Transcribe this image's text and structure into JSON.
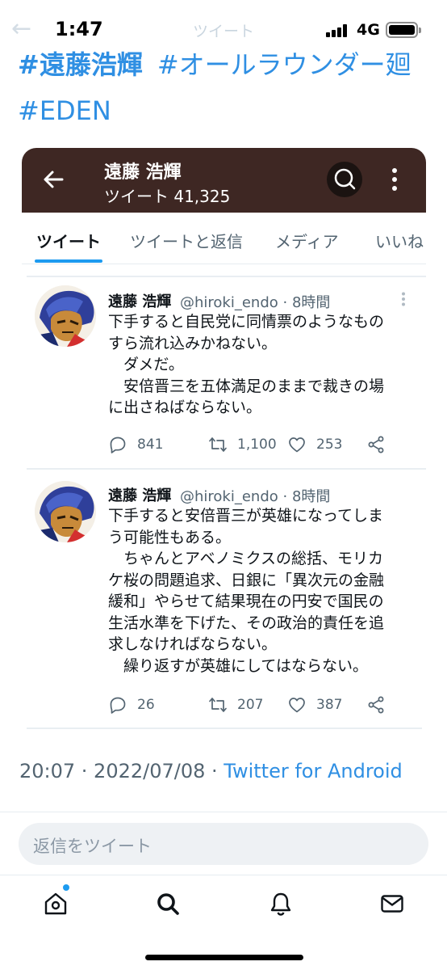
{
  "status_bar": {
    "time": "1:47",
    "network": "4G",
    "behind_title": "ツイート",
    "behind_back": "←"
  },
  "hashtags": [
    {
      "text": "#遠藤浩輝",
      "bold": true
    },
    {
      "text": "#オールラウンダー廻",
      "bold": false
    },
    {
      "text": "#EDEN",
      "bold": false
    }
  ],
  "embedded": {
    "header": {
      "name": "遠藤 浩輝",
      "tweet_count": "ツイート 41,325",
      "background": "#3e2723"
    },
    "tabs": [
      "ツイート",
      "ツイートと返信",
      "メディア",
      "いいね"
    ],
    "active_tab": 0,
    "tweets": [
      {
        "name": "遠藤 浩輝",
        "handle": "@hiroki_endo · 8時間",
        "lines": [
          "下手すると自民党に同情票のようなもの",
          "すら流れ込みかねない。",
          "　ダメだ。",
          "　安倍晋三を五体満足のままで裁きの場",
          "に出さねばならない。"
        ],
        "replies": "841",
        "retweets": "1,100",
        "likes": "253"
      },
      {
        "name": "遠藤 浩輝",
        "handle": "@hiroki_endo · 8時間",
        "lines": [
          "下手すると安倍晋三が英雄になってしま",
          "う可能性もある。",
          "　ちゃんとアベノミクスの総括、モリカ",
          "ケ桜の問題追求、日銀に「異次元の金融",
          "緩和」やらせて結果現在の円安で国民の",
          "生活水準を下げた、その政治的責任を追",
          "求しなければならない。",
          "　繰り返すが英雄にしてはならない。"
        ],
        "replies": "26",
        "retweets": "207",
        "likes": "387"
      }
    ]
  },
  "meta": {
    "timestamp": "20:07 · 2022/07/08 · ",
    "source": "Twitter for Android"
  },
  "reply_placeholder": "返信をツイート",
  "nav": [
    "home-icon",
    "search-icon",
    "notifications-icon",
    "messages-icon"
  ],
  "colors": {
    "accent": "#1d9bf0",
    "hashtag": "#2f8fe3",
    "embed_header": "#3e2723"
  }
}
